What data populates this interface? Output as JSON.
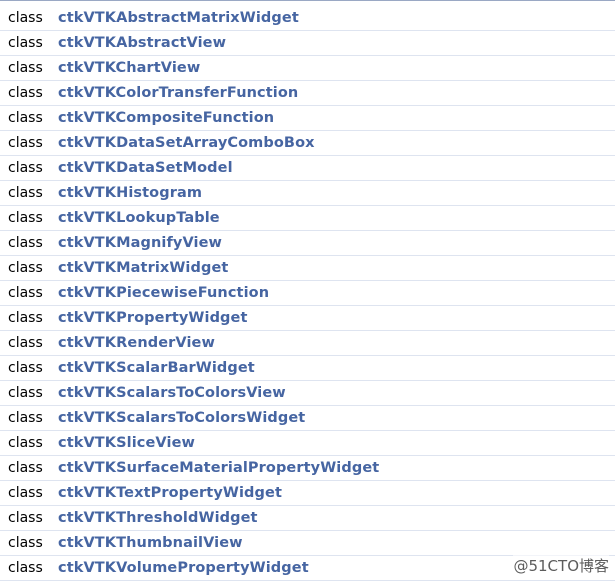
{
  "class_list": {
    "rows": [
      {
        "kind": "class",
        "name": "ctkVTKAbstractMatrixWidget"
      },
      {
        "kind": "class",
        "name": "ctkVTKAbstractView"
      },
      {
        "kind": "class",
        "name": "ctkVTKChartView"
      },
      {
        "kind": "class",
        "name": "ctkVTKColorTransferFunction"
      },
      {
        "kind": "class",
        "name": "ctkVTKCompositeFunction"
      },
      {
        "kind": "class",
        "name": "ctkVTKDataSetArrayComboBox"
      },
      {
        "kind": "class",
        "name": "ctkVTKDataSetModel"
      },
      {
        "kind": "class",
        "name": "ctkVTKHistogram"
      },
      {
        "kind": "class",
        "name": "ctkVTKLookupTable"
      },
      {
        "kind": "class",
        "name": "ctkVTKMagnifyView"
      },
      {
        "kind": "class",
        "name": "ctkVTKMatrixWidget"
      },
      {
        "kind": "class",
        "name": "ctkVTKPiecewiseFunction"
      },
      {
        "kind": "class",
        "name": "ctkVTKPropertyWidget"
      },
      {
        "kind": "class",
        "name": "ctkVTKRenderView"
      },
      {
        "kind": "class",
        "name": "ctkVTKScalarBarWidget"
      },
      {
        "kind": "class",
        "name": "ctkVTKScalarsToColorsView"
      },
      {
        "kind": "class",
        "name": "ctkVTKScalarsToColorsWidget"
      },
      {
        "kind": "class",
        "name": "ctkVTKSliceView"
      },
      {
        "kind": "class",
        "name": "ctkVTKSurfaceMaterialPropertyWidget"
      },
      {
        "kind": "class",
        "name": "ctkVTKTextPropertyWidget"
      },
      {
        "kind": "class",
        "name": "ctkVTKThresholdWidget"
      },
      {
        "kind": "class",
        "name": "ctkVTKThumbnailView"
      },
      {
        "kind": "class",
        "name": "ctkVTKVolumePropertyWidget"
      }
    ]
  },
  "watermark": "@51CTO博客",
  "colors": {
    "link": "#4665a2",
    "row_separator": "#dee4f0"
  }
}
